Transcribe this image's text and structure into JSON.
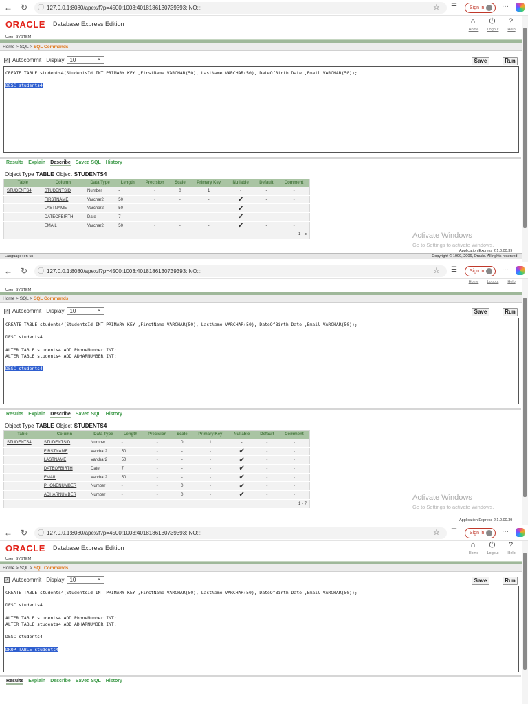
{
  "browser": {
    "url": "127.0.0.1:8080/apex/f?p=4500:1003:4018186130739393::NO:::",
    "sign_in": "Sign in"
  },
  "header": {
    "logo": "ORACLE",
    "edition": "Database Express Edition",
    "home": "Home",
    "logout": "Logout",
    "help": "Help",
    "user": "User: SYSTEM"
  },
  "breadcrumb": {
    "home": "Home",
    "sep": " > ",
    "sql": "SQL",
    "current": "SQL Commands"
  },
  "toolbar": {
    "autocommit": "Autocommit",
    "display": "Display",
    "display_value": "10",
    "save": "Save",
    "run": "Run"
  },
  "tabs": [
    "Results",
    "Explain",
    "Describe",
    "Saved SQL",
    "History"
  ],
  "describe": {
    "object_type_label": "Object Type",
    "object_type": "TABLE",
    "object_label": "Object",
    "object": "STUDENTS4",
    "columns": [
      "Table",
      "Column",
      "Data Type",
      "Length",
      "Precision",
      "Scale",
      "Primary Key",
      "Nullable",
      "Default",
      "Comment"
    ]
  },
  "footer": {
    "language": "Language: en-us",
    "version": "Application Express 2.1.0.00.39",
    "copyright": "Copyright © 1999, 2006, Oracle. All rights reserved."
  },
  "watermark": {
    "title": "Activate Windows",
    "sub": "Go to Settings to activate Windows."
  },
  "panels": [
    {
      "editor_lines": [
        "CREATE TABLE students4(StudentsId INT PRIMARY KEY ,FirstName VARCHAR(50), LastName VARCHAR(50), DateOfBirth Date ,Email VARCHAR(50));",
        "",
        "DESC students4"
      ],
      "selected_line": 2,
      "active_tab": 2,
      "rows": [
        [
          "STUDENTS4",
          "STUDENTSID",
          "Number",
          "-",
          "-",
          "0",
          "1",
          "-",
          "-",
          "-"
        ],
        [
          "",
          "FIRSTNAME",
          "Varchar2",
          "50",
          "-",
          "-",
          "-",
          "✔",
          "-",
          "-"
        ],
        [
          "",
          "LASTNAME",
          "Varchar2",
          "50",
          "-",
          "-",
          "-",
          "✔",
          "-",
          "-"
        ],
        [
          "",
          "DATEOFBIRTH",
          "Date",
          "7",
          "-",
          "-",
          "-",
          "✔",
          "-",
          "-"
        ],
        [
          "",
          "EMAIL",
          "Varchar2",
          "50",
          "-",
          "-",
          "-",
          "✔",
          "-",
          "-"
        ]
      ],
      "pagination": "1 - 5"
    },
    {
      "editor_lines": [
        "CREATE TABLE students4(StudentsId INT PRIMARY KEY ,FirstName VARCHAR(50), LastName VARCHAR(50), DateOfBirth Date ,Email VARCHAR(50));",
        "",
        "DESC students4",
        "",
        "ALTER TABLE students4 ADD PhoneNumber INT;",
        "ALTER TABLE students4 ADD ADHARNUMBER INT;",
        "",
        "DESC students4"
      ],
      "selected_line": 7,
      "active_tab": 2,
      "rows": [
        [
          "STUDENTS4",
          "STUDENTSID",
          "Number",
          "-",
          "-",
          "0",
          "1",
          "-",
          "-",
          "-"
        ],
        [
          "",
          "FIRSTNAME",
          "Varchar2",
          "50",
          "-",
          "-",
          "-",
          "✔",
          "-",
          "-"
        ],
        [
          "",
          "LASTNAME",
          "Varchar2",
          "50",
          "-",
          "-",
          "-",
          "✔",
          "-",
          "-"
        ],
        [
          "",
          "DATEOFBIRTH",
          "Date",
          "7",
          "-",
          "-",
          "-",
          "✔",
          "-",
          "-"
        ],
        [
          "",
          "EMAIL",
          "Varchar2",
          "50",
          "-",
          "-",
          "-",
          "✔",
          "-",
          "-"
        ],
        [
          "",
          "PHONENUMBER",
          "Number",
          "-",
          "-",
          "0",
          "-",
          "✔",
          "-",
          "-"
        ],
        [
          "",
          "ADHARNUMBER",
          "Number",
          "-",
          "-",
          "0",
          "-",
          "✔",
          "-",
          "-"
        ]
      ],
      "pagination": "1 - 7"
    },
    {
      "editor_lines": [
        "CREATE TABLE students4(StudentsId INT PRIMARY KEY ,FirstName VARCHAR(50), LastName VARCHAR(50), DateOfBirth Date ,Email VARCHAR(50));",
        "",
        "DESC students4",
        "",
        "ALTER TABLE students4 ADD PhoneNumber INT;",
        "ALTER TABLE students4 ADD ADHARNUMBER INT;",
        "",
        "DESC students4",
        "",
        "DROP TABLE students4"
      ],
      "selected_line": 9,
      "active_tab": 0
    }
  ]
}
